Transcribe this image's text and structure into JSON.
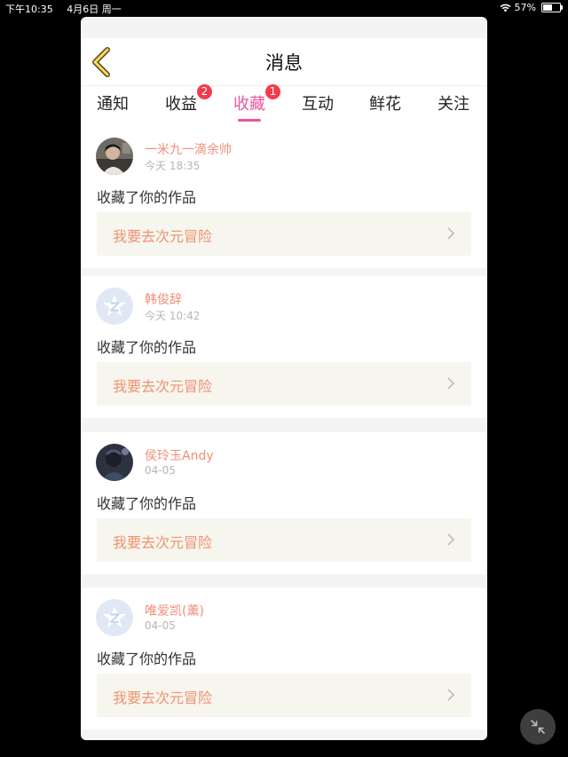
{
  "status_bar": {
    "time": "下午10:35",
    "date": "4月6日 周一",
    "battery_percent": "57%",
    "battery_level": 0.57
  },
  "header": {
    "title": "消息",
    "back_icon": "chevron-left-icon"
  },
  "tabs": [
    {
      "label": "通知",
      "badge": "",
      "active": false
    },
    {
      "label": "收益",
      "badge": "2",
      "active": false
    },
    {
      "label": "收藏",
      "badge": "1",
      "active": true
    },
    {
      "label": "互动",
      "badge": "",
      "active": false
    },
    {
      "label": "鲜花",
      "badge": "",
      "active": false
    },
    {
      "label": "关注",
      "badge": "",
      "active": false
    }
  ],
  "messages": [
    {
      "user": "一米九一滴余帅",
      "time": "今天 18:35",
      "action": "收藏了你的作品",
      "work_title": "我要去次元冒险",
      "avatar": "photo"
    },
    {
      "user": "韩俊辞",
      "time": "今天 10:42",
      "action": "收藏了你的作品",
      "work_title": "我要去次元冒险",
      "avatar": "default"
    },
    {
      "user": "侯玲玉Andy",
      "time": "04-05",
      "action": "收藏了你的作品",
      "work_title": "我要去次元冒险",
      "avatar": "photo"
    },
    {
      "user": "唯爱凯(薰)",
      "time": "04-05",
      "action": "收藏了你的作品",
      "work_title": "我要去次元冒险",
      "avatar": "default"
    }
  ],
  "colors": {
    "accent_pink": "#e9559b",
    "badge_red": "#f23c4d",
    "username_orange": "#f08f7a",
    "work_title_orange": "#f0926f",
    "work_bg": "#f6f5ee"
  }
}
